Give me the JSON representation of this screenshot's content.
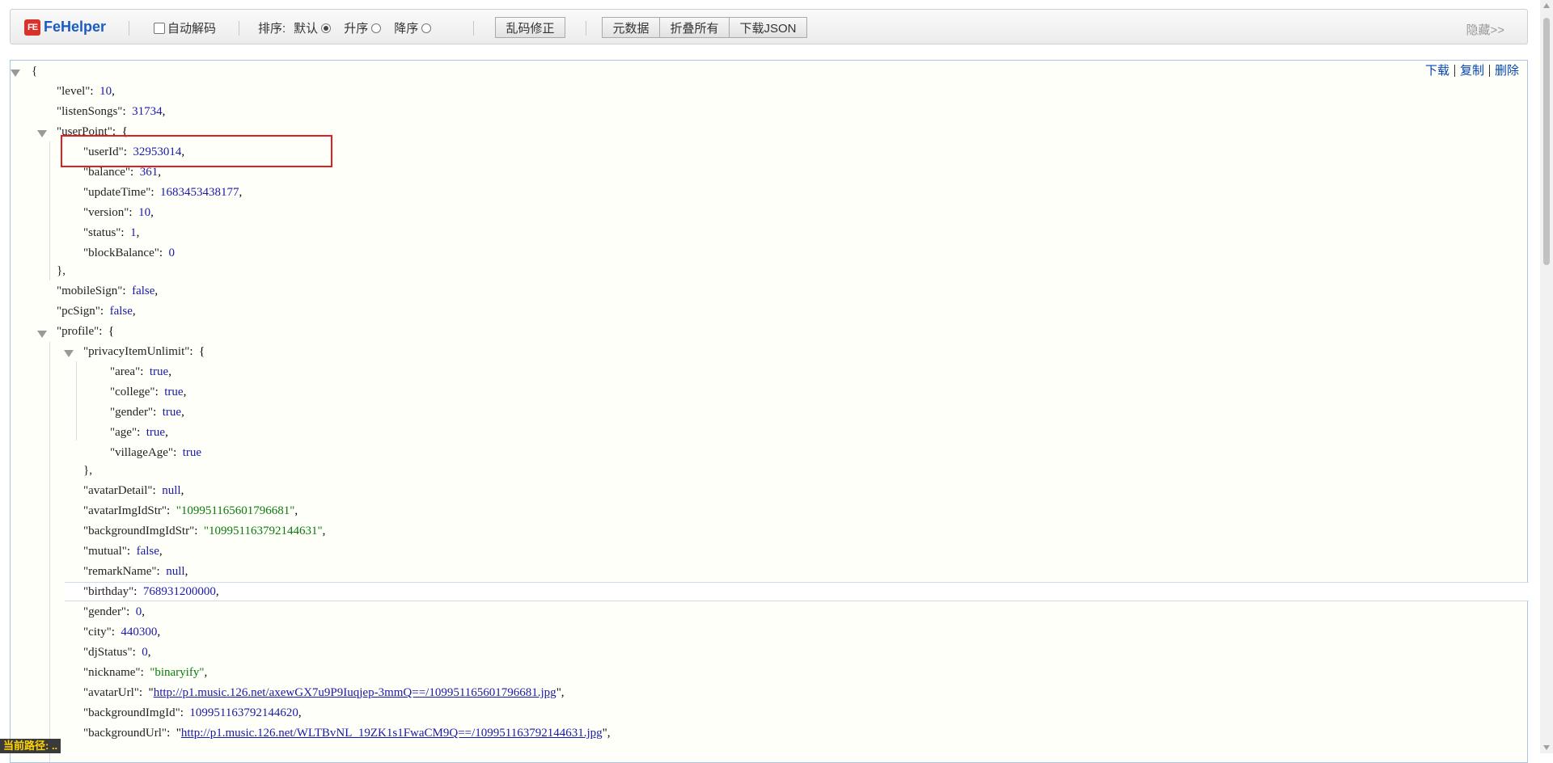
{
  "toolbar": {
    "brand_logo": "FE",
    "brand": "FeHelper",
    "auto_decode": "自动解码",
    "sort_label": "排序:",
    "sort_default": "默认",
    "sort_asc": "升序",
    "sort_desc": "降序",
    "fix_encoding": "乱码修正",
    "metadata": "元数据",
    "collapse_all": "折叠所有",
    "download_json": "下载JSON",
    "hide": "隐藏>>"
  },
  "viewer_actions": {
    "download": "下载",
    "copy": "复制",
    "delete": "删除"
  },
  "json": {
    "open_brace": "{",
    "level_key": "\"level\"",
    "level_val": "10",
    "listenSongs_key": "\"listenSongs\"",
    "listenSongs_val": "31734",
    "userPoint_key": "\"userPoint\"",
    "userId_key": "\"userId\"",
    "userId_val": "32953014",
    "balance_key": "\"balance\"",
    "balance_val": "361",
    "updateTime_key": "\"updateTime\"",
    "updateTime_val": "1683453438177",
    "version_key": "\"version\"",
    "version_val": "10",
    "status_key": "\"status\"",
    "status_val": "1",
    "blockBalance_key": "\"blockBalance\"",
    "blockBalance_val": "0",
    "close_obj_comma": "},",
    "mobileSign_key": "\"mobileSign\"",
    "mobileSign_val": "false",
    "pcSign_key": "\"pcSign\"",
    "pcSign_val": "false",
    "profile_key": "\"profile\"",
    "privacy_key": "\"privacyItemUnlimit\"",
    "area_key": "\"area\"",
    "area_val": "true",
    "college_key": "\"college\"",
    "college_val": "true",
    "gender_p_key": "\"gender\"",
    "gender_p_val": "true",
    "age_key": "\"age\"",
    "age_val": "true",
    "villageAge_key": "\"villageAge\"",
    "villageAge_val": "true",
    "avatarDetail_key": "\"avatarDetail\"",
    "avatarDetail_val": "null",
    "avatarImgIdStr_key": "\"avatarImgIdStr\"",
    "avatarImgIdStr_val": "\"109951165601796681\"",
    "backgroundImgIdStr_key": "\"backgroundImgIdStr\"",
    "backgroundImgIdStr_val": "\"109951163792144631\"",
    "mutual_key": "\"mutual\"",
    "mutual_val": "false",
    "remarkName_key": "\"remarkName\"",
    "remarkName_val": "null",
    "birthday_key": "\"birthday\"",
    "birthday_val": "768931200000",
    "gender_key": "\"gender\"",
    "gender_val": "0",
    "city_key": "\"city\"",
    "city_val": "440300",
    "djStatus_key": "\"djStatus\"",
    "djStatus_val": "0",
    "nickname_key": "\"nickname\"",
    "nickname_val": "\"binaryify\"",
    "avatarUrl_key": "\"avatarUrl\"",
    "avatarUrl_val": "http://p1.music.126.net/axewGX7u9P9Iuqjep-3mmQ==/109951165601796681.jpg",
    "backgroundImgId_key": "\"backgroundImgId\"",
    "backgroundImgId_val": "109951163792144620",
    "backgroundUrl_key": "\"backgroundUrl\"",
    "backgroundUrl_val": "http://p1.music.126.net/WLTBvNL_19ZK1s1FwaCM9Q==/109951163792144631.jpg"
  },
  "status_bar": "当前路径: .."
}
